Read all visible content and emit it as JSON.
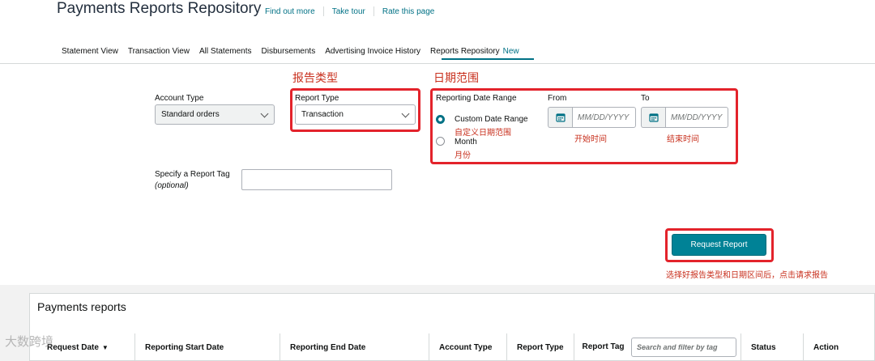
{
  "header": {
    "title": "Payments Reports Repository",
    "links": [
      "Find out more",
      "Take tour",
      "Rate this page"
    ]
  },
  "nav": {
    "tabs": [
      "Statement View",
      "Transaction View",
      "All Statements",
      "Disbursements",
      "Advertising Invoice History",
      "Reports Repository"
    ],
    "active_tab": "Reports Repository",
    "new_badge": "New"
  },
  "annotations": {
    "report_type_heading": "报告类型",
    "date_range_heading": "日期范围",
    "custom_range_note": "自定义日期范围",
    "month_note": "月份",
    "from_note": "开始时间",
    "to_note": "结束时间",
    "request_note": "选择好报告类型和日期区间后，点击请求报告"
  },
  "form": {
    "account_type_label": "Account Type",
    "account_type_value": "Standard orders",
    "report_type_label": "Report Type",
    "report_type_value": "Transaction",
    "date_range_label": "Reporting Date Range",
    "custom_range_option": "Custom Date Range",
    "month_option": "Month",
    "from_label": "From",
    "to_label": "To",
    "from_placeholder": "MM/DD/YYYY",
    "to_placeholder": "MM/DD/YYYY",
    "tag_label": "Specify a Report Tag",
    "tag_optional": "(optional)",
    "tag_value": "",
    "request_button": "Request Report",
    "selected_range_option": "Custom Date Range"
  },
  "reports": {
    "title": "Payments reports",
    "columns": [
      "Request Date",
      "Reporting Start Date",
      "Reporting End Date",
      "Account Type",
      "Report Type",
      "Report Tag",
      "Status",
      "Action"
    ],
    "tag_search_placeholder": "Search and filter by tag"
  },
  "watermark": "大数跨境",
  "colors": {
    "accent": "#007185",
    "button": "#008296",
    "annotation": "#c8301e",
    "annotation_box": "#e3232b"
  },
  "icons": [
    "calendar-icon",
    "chevron-down-icon",
    "sort-icon"
  ]
}
